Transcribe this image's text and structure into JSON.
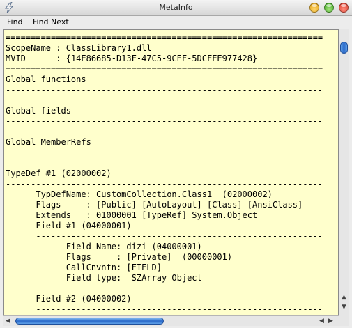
{
  "window": {
    "title": "MetaInfo"
  },
  "menu": {
    "items": [
      "Find",
      "Find Next"
    ]
  },
  "content": {
    "lines": [
      "===============================================================",
      "ScopeName : ClassLibrary1.dll",
      "MVID      : {14E86685-D13F-47C5-9CEF-5DCFEE977428}",
      "===============================================================",
      "Global functions",
      "---------------------------------------------------------------",
      "",
      "Global fields",
      "---------------------------------------------------------------",
      "",
      "Global MemberRefs",
      "---------------------------------------------------------------",
      "",
      "TypeDef #1 (02000002)",
      "---------------------------------------------------------------",
      "      TypDefName: CustomCollection.Class1  (02000002)",
      "      Flags     : [Public] [AutoLayout] [Class] [AnsiClass]",
      "      Extends   : 01000001 [TypeRef] System.Object",
      "      Field #1 (04000001)",
      "      ---------------------------------------------------------",
      "            Field Name: dizi (04000001)",
      "            Flags     : [Private]  (00000001)",
      "            CallCnvntn: [FIELD]",
      "            Field type:  SZArray Object",
      "",
      "      Field #2 (04000002)",
      "      ---------------------------------------------------------"
    ]
  },
  "icons": {
    "app": "lightning-icon",
    "minimize": "minimize-button",
    "maximize": "zoom-button",
    "close": "close-button"
  },
  "colors": {
    "content_bg": "#ffffcc",
    "scroll_thumb": "#2a69c9"
  }
}
